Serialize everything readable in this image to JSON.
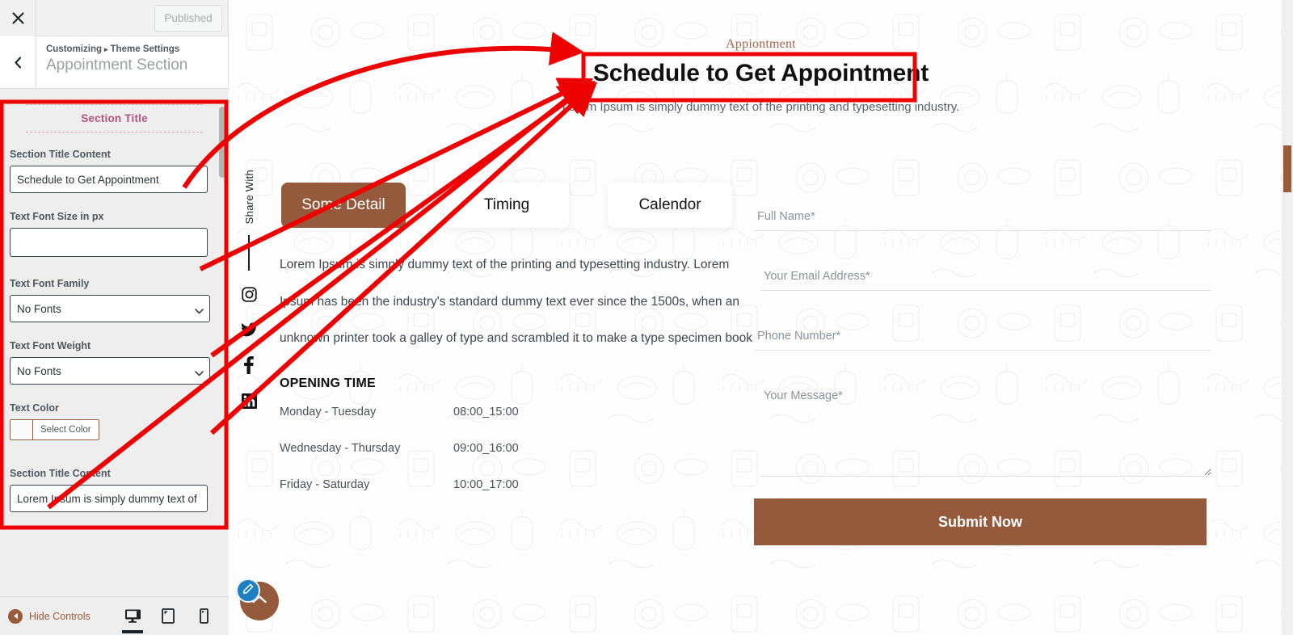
{
  "customizer": {
    "close_icon": "close-icon",
    "publish_label": "Published",
    "back_icon": "chevron-left-icon",
    "breadcrumb_prefix": "Customizing",
    "breadcrumb_separator": "▸",
    "breadcrumb_parent": "Theme Settings",
    "section_name": "Appointment Section",
    "group_title": "Section Title",
    "fields": {
      "title_content_label": "Section Title Content",
      "title_content_value": "Schedule to Get Appointment",
      "font_size_label": "Text Font Size in px",
      "font_size_value": "",
      "font_family_label": "Text Font Family",
      "font_family_value": "No Fonts",
      "font_weight_label": "Text Font Weight",
      "font_weight_value": "No Fonts",
      "text_color_label": "Text Color",
      "text_color_button": "Select Color",
      "next_title_content_label": "Section Title Content",
      "next_title_content_value": "Lorem Ipsum is simply dummy text of the p"
    },
    "footer": {
      "hide_controls_label": "Hide Controls",
      "devices": [
        {
          "name": "desktop-preview",
          "icon": "desktop-icon",
          "active": true
        },
        {
          "name": "tablet-preview",
          "icon": "tablet-icon",
          "active": false
        },
        {
          "name": "mobile-preview",
          "icon": "mobile-icon",
          "active": false
        }
      ]
    }
  },
  "preview": {
    "kicker": "Appiontment",
    "heading": "Schedule to Get Appointment",
    "subheading": "Lorem Ipsum is simply dummy text of the printing and typesetting industry.",
    "share": {
      "label": "Share With",
      "icons": [
        "instagram-icon",
        "twitter-icon",
        "facebook-icon",
        "linkedin-icon"
      ]
    },
    "tabs": [
      {
        "label": "Some Detail",
        "active": true
      },
      {
        "label": "Timing",
        "active": false
      },
      {
        "label": "Calendor",
        "active": false
      }
    ],
    "detail_paragraph": "Lorem Ipsum is simply dummy text of the printing and typesetting industry. Lorem Ipsum has been the industry's standard dummy text ever since the 1500s, when an unknown printer took a galley of type and scrambled it to make a type specimen book",
    "opening_heading": "OPENING TIME",
    "opening_hours": [
      {
        "days": "Monday - Tuesday",
        "time": "08:00_15:00"
      },
      {
        "days": "Wednesday - Thursday",
        "time": "09:00_16:00"
      },
      {
        "days": "Friday - Saturday",
        "time": "10:00_17:00"
      }
    ],
    "form": {
      "full_name_placeholder": "Full Name*",
      "full_name_value": "",
      "email_placeholder": "Your Email Address*",
      "email_value": "",
      "phone_placeholder": "Phone Number*",
      "phone_value": "",
      "message_placeholder": "Your Message*",
      "message_value": "",
      "submit_label": "Submit Now"
    },
    "fab": {
      "scroll_top_icon": "chevron-up-icon",
      "edit_icon": "pencil-icon"
    }
  },
  "colors": {
    "brand_brown": "#955a3c",
    "panel_title_pink": "#b4547e",
    "annotation_red": "#ee0000",
    "heading_black": "#111111"
  }
}
